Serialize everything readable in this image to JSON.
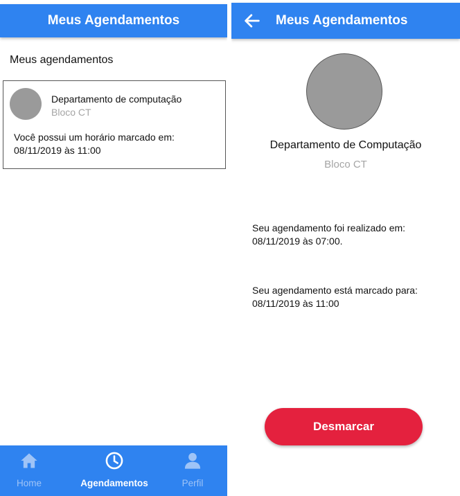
{
  "colors": {
    "primary": "#2f83f0",
    "danger": "#e4213e",
    "avatar": "#9a9a9a",
    "muted": "#a5a5a5"
  },
  "list_screen": {
    "appbar_title": "Meus Agendamentos",
    "section_title": "Meus agendamentos",
    "appointments": [
      {
        "name": "Departamento de computação",
        "block": "Bloco CT",
        "message_line1": "Você possui um horário marcado em:",
        "message_line2": "08/11/2019 às 11:00"
      }
    ],
    "bottom_nav": {
      "items": [
        {
          "label": "Home",
          "icon": "home-icon",
          "active": false
        },
        {
          "label": "Agendamentos",
          "icon": "clock-icon",
          "active": true
        },
        {
          "label": "Perfil",
          "icon": "person-icon",
          "active": false
        }
      ]
    }
  },
  "detail_screen": {
    "appbar_title": "Meus Agendamentos",
    "back_icon": "arrow-left-icon",
    "department_name": "Departamento de Computação",
    "block": "Bloco CT",
    "created_line1": "Seu agendamento foi realizado em:",
    "created_line2": "08/11/2019 às 07:00.",
    "scheduled_line1": "Seu agendamento está marcado para:",
    "scheduled_line2": "08/11/2019 às 11:00",
    "cancel_button_label": "Desmarcar"
  }
}
